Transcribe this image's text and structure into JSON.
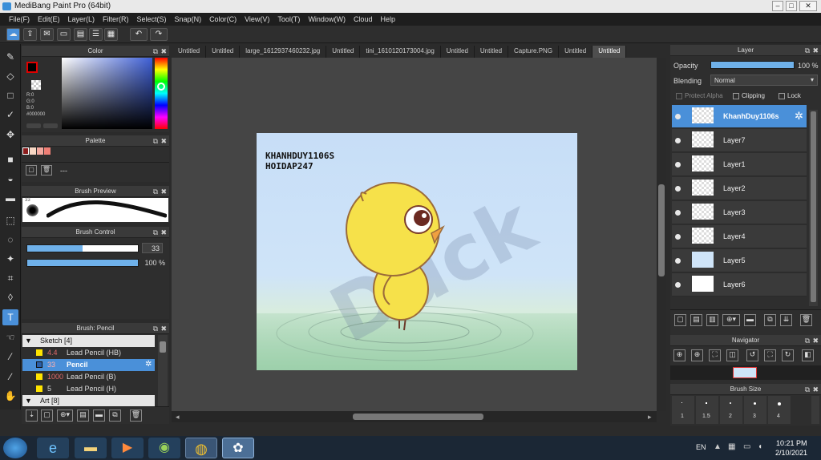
{
  "title": "MediBang Paint Pro (64bit)",
  "window_buttons": {
    "minimize": "–",
    "maximize": "□",
    "close": "✕"
  },
  "menu": [
    "File(F)",
    "Edit(E)",
    "Layer(L)",
    "Filter(R)",
    "Select(S)",
    "Snap(N)",
    "Color(C)",
    "View(V)",
    "Tool(T)",
    "Window(W)",
    "Cloud",
    "Help"
  ],
  "tabs": [
    "Untitled",
    "Untitled",
    "large_1612937460232.jpg",
    "Untitled",
    "tini_1610120173004.jpg",
    "Untitled",
    "Untitled",
    "Capture.PNG",
    "Untitled",
    "Untitled"
  ],
  "active_tab": 9,
  "color_panel": {
    "title": "Color",
    "r": "R:0",
    "g": "G:0",
    "b": "B:0",
    "hex": "#000000",
    "colors": {
      "fg": "#000000",
      "accent": "#e00000"
    }
  },
  "palette_panel": {
    "title": "Palette",
    "swatches": [
      "#8b1c1c",
      "#f7d7c4",
      "#f3a99f",
      "#ef7f76"
    ],
    "label": "---"
  },
  "brush_preview": {
    "title": "Brush Preview",
    "size_label": "33"
  },
  "brush_control": {
    "title": "Brush Control",
    "size": "33",
    "opacity": "100 %",
    "size_fraction": 0.5,
    "opacity_fraction": 1.0
  },
  "brush_panel": {
    "title": "Brush: Pencil",
    "groups": [
      {
        "name": "Sketch [4]",
        "items": [
          {
            "size": "4.4",
            "name": "Lead Pencil (HB)",
            "selected": false
          },
          {
            "size": "33",
            "name": "Pencil",
            "selected": true
          },
          {
            "size": "1000",
            "name": "Lead Pencil (B)",
            "selected": false
          },
          {
            "size": "5",
            "name": "Lead Pencil (H)",
            "selected": false
          }
        ]
      },
      {
        "name": "Art [8]"
      }
    ]
  },
  "canvas_text": {
    "line1": "KHANHDUY1106S",
    "line2": "HOIDAP247",
    "watermark": "Duck"
  },
  "layer_panel": {
    "title": "Layer",
    "opacity_label": "Opacity",
    "opacity_value": "100 %",
    "blending_label": "Blending",
    "blending_value": "Normal",
    "protect_alpha": "Protect Alpha",
    "clipping": "Clipping",
    "lock": "Lock",
    "layers": [
      {
        "name": "KhanhDuy1106s",
        "selected": true
      },
      {
        "name": "Layer7",
        "selected": false
      },
      {
        "name": "Layer1",
        "selected": false
      },
      {
        "name": "Layer2",
        "selected": false
      },
      {
        "name": "Layer3",
        "selected": false
      },
      {
        "name": "Layer4",
        "selected": false
      },
      {
        "name": "Layer5",
        "selected": false
      },
      {
        "name": "Layer6",
        "selected": false
      }
    ]
  },
  "navigator": {
    "title": "Navigator"
  },
  "brush_size": {
    "title": "Brush Size",
    "sizes": [
      "1",
      "1.5",
      "2",
      "3",
      "4"
    ]
  },
  "taskbar": {
    "lang": "EN",
    "time": "10:21 PM",
    "date": "2/10/2021"
  }
}
